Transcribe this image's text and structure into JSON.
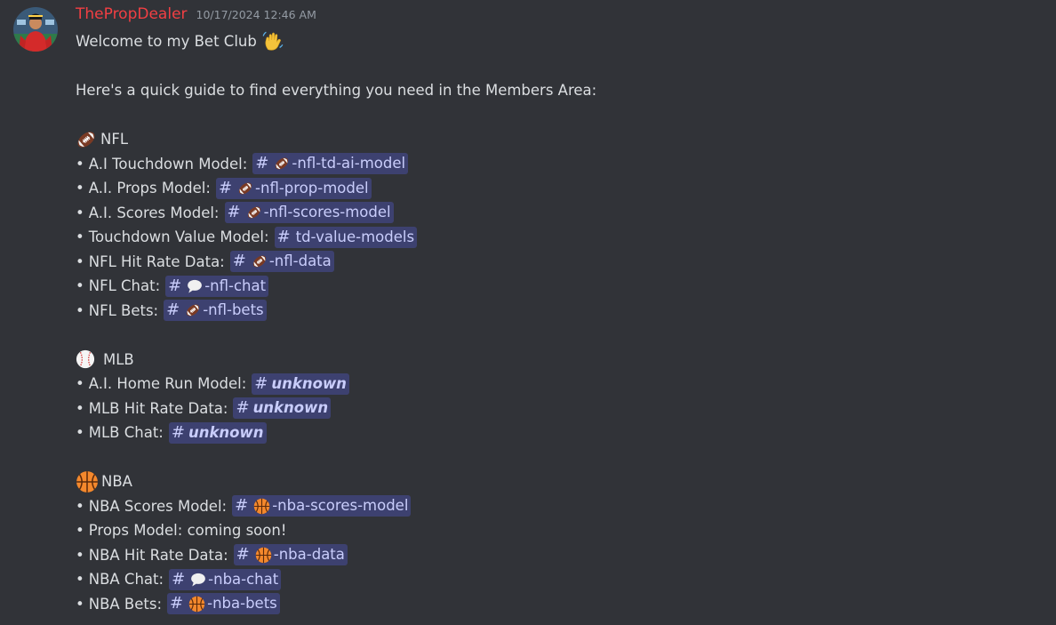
{
  "message": {
    "author": "ThePropDealer",
    "timestamp": "10/17/2024 12:46 AM",
    "welcome_text": "Welcome to my Bet Club",
    "guide_text": "Here's a quick guide to find everything you need in the Members Area:"
  },
  "bullet": "•",
  "hash": "#",
  "sections": {
    "nfl": {
      "title": "NFL",
      "items": [
        {
          "label": "A.I Touchdown Model:",
          "channel": "-nfl-td-ai-model",
          "icon": "football-icon"
        },
        {
          "label": "A.I. Props Model:",
          "channel": "-nfl-prop-model",
          "icon": "football-icon"
        },
        {
          "label": "A.I. Scores Model:",
          "channel": "-nfl-scores-model",
          "icon": "football-icon"
        },
        {
          "label": "Touchdown Value Model:",
          "channel": "td-value-models",
          "icon": ""
        },
        {
          "label": "NFL Hit Rate Data:",
          "channel": "-nfl-data",
          "icon": "football-icon"
        },
        {
          "label": "NFL Chat:",
          "channel": "-nfl-chat",
          "icon": "speech-bubble-icon"
        },
        {
          "label": "NFL Bets:",
          "channel": "-nfl-bets",
          "icon": "football-icon"
        }
      ]
    },
    "mlb": {
      "title": "MLB",
      "items": [
        {
          "label": "A.I. Home Run Model:",
          "channel": "unknown"
        },
        {
          "label": "MLB Hit Rate Data:",
          "channel": "unknown"
        },
        {
          "label": "MLB Chat:",
          "channel": "unknown"
        }
      ]
    },
    "nba": {
      "title": "NBA",
      "items": [
        {
          "label": "NBA Scores Model:",
          "channel": "-nba-scores-model",
          "icon": "basketball-icon"
        },
        {
          "label": "Props Model: coming soon!"
        },
        {
          "label": "NBA Hit Rate Data:",
          "channel": "-nba-data",
          "icon": "basketball-icon"
        },
        {
          "label": "NBA Chat:",
          "channel": "-nba-chat",
          "icon": "speech-bubble-icon"
        },
        {
          "label": "NBA Bets:",
          "channel": "-nba-bets",
          "icon": "basketball-icon"
        }
      ]
    }
  },
  "colors": {
    "background": "#313338",
    "text": "#dbdee1",
    "author": "#f23f43",
    "timestamp": "#949ba4",
    "mention_text": "#c9cdfb",
    "mention_bg": "#3c4270"
  }
}
